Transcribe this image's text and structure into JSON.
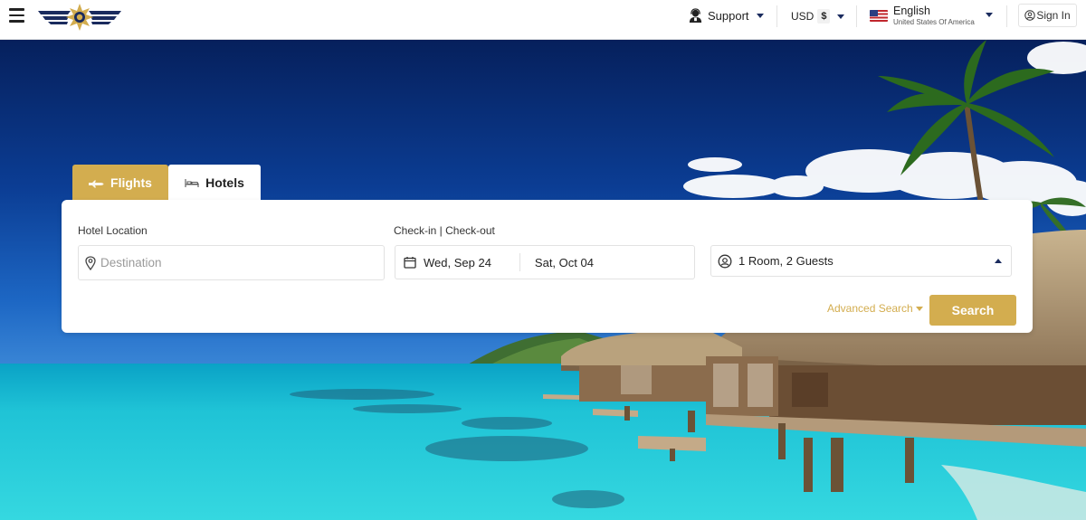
{
  "header": {
    "support_label": "Support",
    "currency_code": "USD",
    "currency_symbol": "$",
    "language_name": "English",
    "language_region": "United States Of America",
    "signin_label": "Sign In"
  },
  "search": {
    "tabs": [
      {
        "label": "Flights",
        "active": false
      },
      {
        "label": "Hotels",
        "active": true
      }
    ],
    "location_label": "Hotel Location",
    "location_placeholder": "Destination",
    "dates_label": "Check-in | Check-out",
    "checkin": "Wed, Sep 24",
    "checkout": "Sat, Oct 04",
    "guests": "1 Room, 2 Guests",
    "advanced_label": "Advanced Search",
    "search_label": "Search"
  },
  "colors": {
    "accent": "#d3ad4f",
    "navy": "#1a2b5e",
    "sky": "#0d3f95",
    "water": "#27c6d4"
  },
  "icons": [
    "menu-icon",
    "support-agent-icon",
    "us-flag-icon",
    "user-icon",
    "plane-icon",
    "bed-icon",
    "location-pin-icon",
    "calendar-icon",
    "guests-icon"
  ]
}
